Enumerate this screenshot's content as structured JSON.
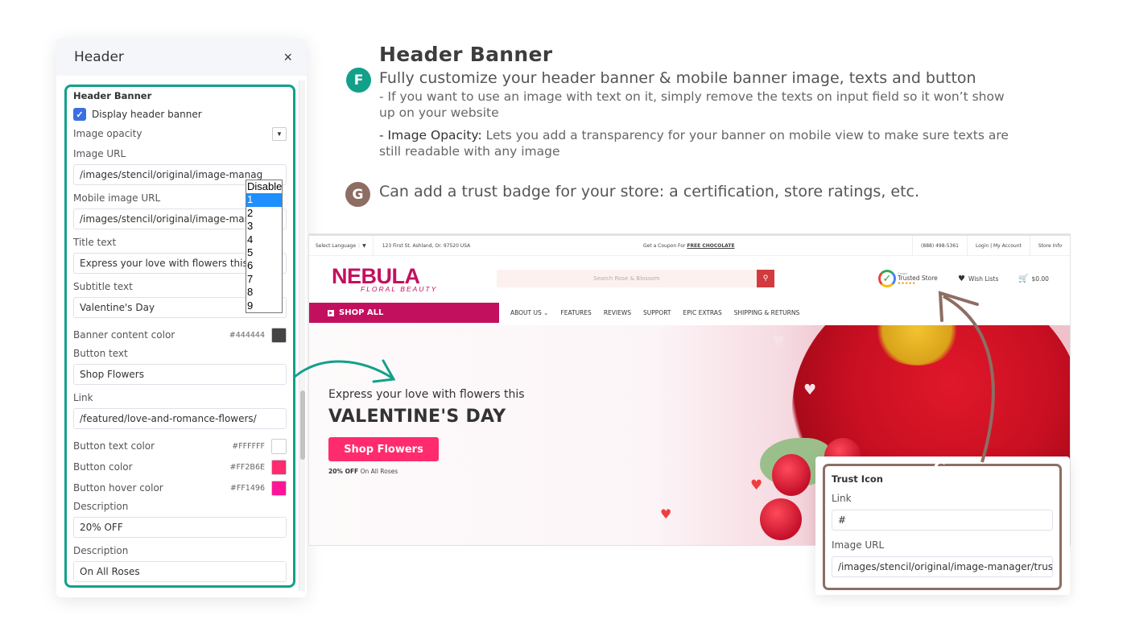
{
  "settings_panel": {
    "title": "Header",
    "close_icon": "×",
    "section_title": "Header Banner",
    "display_banner": {
      "label": "Display header banner",
      "checked": true
    },
    "image_opacity": {
      "label": "Image opacity",
      "options": [
        "Disable",
        "1",
        "2",
        "3",
        "4",
        "5",
        "6",
        "7",
        "8",
        "9"
      ],
      "selected": "1"
    },
    "image_url": {
      "label": "Image URL",
      "value": "/images/stencil/original/image-manag"
    },
    "mobile_image_url": {
      "label": "Mobile image URL",
      "value": "/images/stencil/original/image-manag"
    },
    "title_text": {
      "label": "Title text",
      "value": "Express your love with flowers this"
    },
    "subtitle_text": {
      "label": "Subtitle text",
      "value": "Valentine's Day"
    },
    "banner_content_color": {
      "label": "Banner content color",
      "hex": "#444444",
      "color": "#444444"
    },
    "button_text": {
      "label": "Button text",
      "value": "Shop Flowers"
    },
    "link": {
      "label": "Link",
      "value": "/featured/love-and-romance-flowers/"
    },
    "button_text_color": {
      "label": "Button text color",
      "hex": "#FFFFFF",
      "color": "#FFFFFF"
    },
    "button_color": {
      "label": "Button color",
      "hex": "#FF2B6E",
      "color": "#FF2B6E"
    },
    "button_hover_color": {
      "label": "Button hover color",
      "hex": "#FF1496",
      "color": "#FF1496"
    },
    "description_1": {
      "label": "Description",
      "value": "20% OFF"
    },
    "description_2": {
      "label": "Description",
      "value": "On All Roses"
    }
  },
  "description": {
    "heading": "Header Banner",
    "badge_f": "F",
    "lead_f": "Fully customize your header banner & mobile banner image, texts and button",
    "note_1": "- If you want to use an image with text on it, simply remove the texts on input field so it won’t show up on your website",
    "note_2_prefix": "- Image Opacity:",
    "note_2_text": " Lets you add a transparency for your banner on mobile view to make sure texts are still readable with any image",
    "badge_g": "G",
    "lead_g": "Can add a trust badge for your store: a certification, store ratings, etc."
  },
  "website": {
    "topbar": {
      "language": "Select Language",
      "language_caret": "▼",
      "address": "123 First St. Ashland, Or. 97520 USA",
      "coupon_prefix": "Get a Coupon For ",
      "coupon_link": "FREE CHOCOLATE",
      "phone": "(888) 498-5361",
      "account": "Login | My Account",
      "store_info": "Store Info"
    },
    "logo": {
      "main": "NEBULA",
      "sub": "FLORAL BEAUTY"
    },
    "search_placeholder": "Search Rose & Blossom",
    "trust_badge": {
      "small": "Google",
      "label": "Trusted Store",
      "stars": "★★★★★"
    },
    "wishlist": "Wish Lists",
    "cart_total": "$0.00",
    "shop_all": "SHOP ALL",
    "nav": [
      "ABOUT US ⌄",
      "FEATURES",
      "REVIEWS",
      "SUPPORT",
      "EPIC EXTRAS",
      "SHIPPING & RETURNS"
    ],
    "hero": {
      "title": "Express your love with flowers this",
      "subtitle": "VALENTINE'S DAY",
      "button": "Shop Flowers",
      "desc_bold": "20% OFF",
      "desc_rest": " On All Roses"
    }
  },
  "trust_panel": {
    "badge": "G",
    "section_title": "Trust Icon",
    "link": {
      "label": "Link",
      "value": "#"
    },
    "image_url": {
      "label": "Image URL",
      "value": "/images/stencil/original/image-manager/trus"
    }
  },
  "colors": {
    "teal": "#12a08a",
    "brown": "#8d6e63",
    "brand": "#c3105e",
    "hero_button": "#ff2b6e"
  }
}
